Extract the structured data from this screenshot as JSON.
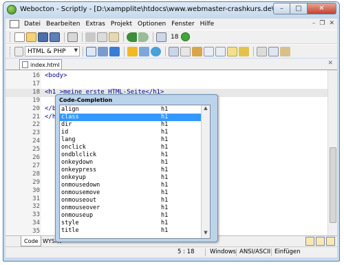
{
  "window": {
    "title": "Webocton - Scriptly - [D:\\xampplite\\htdocs\\www.webmaster-crashkurs.de\\index.html]",
    "minimize": "–",
    "maximize": "□",
    "close": "✕"
  },
  "menu": [
    "Datei",
    "Bearbeiten",
    "Extras",
    "Projekt",
    "Optionen",
    "Fenster",
    "Hilfe"
  ],
  "mdi_buttons": {
    "minimize": "–",
    "restore": "❐",
    "close": "✕"
  },
  "toolbar1": {
    "font_size": "18"
  },
  "toolbar2": {
    "language": "HTML & PHP"
  },
  "tab": {
    "label": "index.html",
    "close": "✕"
  },
  "editor": {
    "lines": [
      {
        "num": "16",
        "code": "<body>",
        "kind": "tag"
      },
      {
        "num": "17",
        "code": "",
        "kind": "plain"
      },
      {
        "num": "18",
        "code": "<h1 >meine erste HTML-Seite</h1>",
        "kind": "tag",
        "current": true
      },
      {
        "num": "19",
        "code": "",
        "kind": "plain"
      },
      {
        "num": "20",
        "code": "</bo",
        "kind": "tag"
      },
      {
        "num": "21",
        "code": "</ht",
        "kind": "tag"
      },
      {
        "num": "22",
        "code": "",
        "kind": "plain"
      },
      {
        "num": "23",
        "code": "",
        "kind": "plain"
      },
      {
        "num": "24",
        "code": "",
        "kind": "plain"
      },
      {
        "num": "25",
        "code": "",
        "kind": "plain"
      },
      {
        "num": "26",
        "code": "",
        "kind": "plain"
      },
      {
        "num": "27",
        "code": "",
        "kind": "plain"
      },
      {
        "num": "28",
        "code": "",
        "kind": "plain"
      },
      {
        "num": "29",
        "code": "",
        "kind": "plain"
      },
      {
        "num": "30",
        "code": "",
        "kind": "plain"
      },
      {
        "num": "31",
        "code": "",
        "kind": "plain"
      },
      {
        "num": "32",
        "code": "",
        "kind": "plain"
      },
      {
        "num": "33",
        "code": "",
        "kind": "plain"
      },
      {
        "num": "34",
        "code": "",
        "kind": "plain"
      },
      {
        "num": "35",
        "code": "",
        "kind": "plain"
      }
    ]
  },
  "completion": {
    "title": "Code-Completion",
    "items": [
      {
        "name": "align",
        "type": "h1"
      },
      {
        "name": "class",
        "type": "h1",
        "selected": true
      },
      {
        "name": "dir",
        "type": "h1"
      },
      {
        "name": "id",
        "type": "h1"
      },
      {
        "name": "lang",
        "type": "h1"
      },
      {
        "name": "onclick",
        "type": "h1"
      },
      {
        "name": "ondblclick",
        "type": "h1"
      },
      {
        "name": "onkeydown",
        "type": "h1"
      },
      {
        "name": "onkeypress",
        "type": "h1"
      },
      {
        "name": "onkeyup",
        "type": "h1"
      },
      {
        "name": "onmousedown",
        "type": "h1"
      },
      {
        "name": "onmousemove",
        "type": "h1"
      },
      {
        "name": "onmouseout",
        "type": "h1"
      },
      {
        "name": "onmouseover",
        "type": "h1"
      },
      {
        "name": "onmouseup",
        "type": "h1"
      },
      {
        "name": "style",
        "type": "h1"
      },
      {
        "name": "title",
        "type": "h1"
      }
    ]
  },
  "views": {
    "code": "Code",
    "wysiwyg": "WYSIW"
  },
  "status": {
    "position": "5 : 18",
    "line_endings": "Windows",
    "encoding": "ANSI/ASCII",
    "mode": "Einfügen"
  }
}
